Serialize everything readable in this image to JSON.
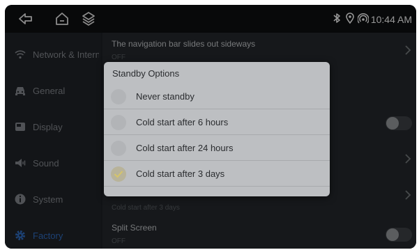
{
  "status_bar": {
    "time": "10:44 AM",
    "icons": [
      "bluetooth-icon",
      "location-icon",
      "wifi-hotspot-icon"
    ]
  },
  "nav": {
    "icons": [
      "back-icon",
      "home-icon",
      "layers-icon"
    ]
  },
  "sidebar": {
    "items": [
      {
        "label": "Network & Internet",
        "icon": "wifi-icon"
      },
      {
        "label": "General",
        "icon": "car-icon"
      },
      {
        "label": "Display",
        "icon": "display-icon"
      },
      {
        "label": "Sound",
        "icon": "speaker-icon"
      },
      {
        "label": "System",
        "icon": "info-icon"
      },
      {
        "label": "Factory",
        "icon": "gear-icon",
        "active": true
      }
    ]
  },
  "settings": {
    "nav_bar_slide": {
      "title": "The navigation bar slides out sideways",
      "value": "OFF"
    },
    "standby": {
      "value": "Cold start after 3 days"
    },
    "split_screen": {
      "title": "Split Screen",
      "value": "OFF"
    }
  },
  "dialog": {
    "title": "Standby Options",
    "options": [
      {
        "label": "Never standby",
        "selected": false
      },
      {
        "label": "Cold start after 6 hours",
        "selected": false
      },
      {
        "label": "Cold start after 24 hours",
        "selected": false
      },
      {
        "label": "Cold start after 3 days",
        "selected": true
      }
    ]
  },
  "colors": {
    "accent": "#2c64b3",
    "checkmark": "#d6c56a"
  }
}
